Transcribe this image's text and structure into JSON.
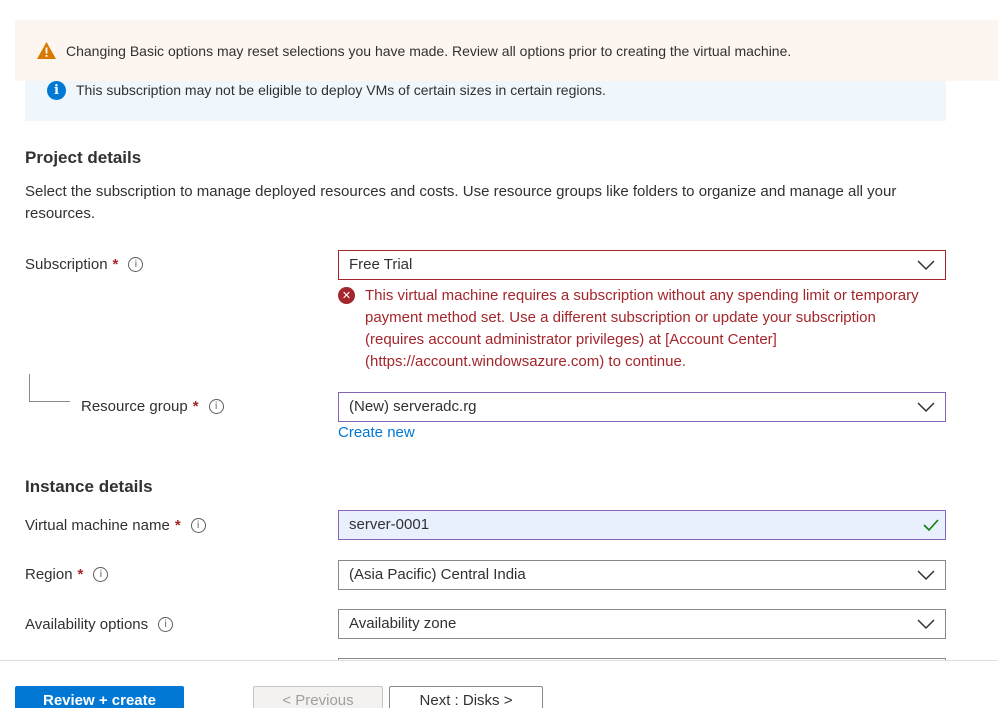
{
  "banners": {
    "warning": "Changing Basic options may reset selections you have made. Review all options prior to creating the virtual machine.",
    "info": "This subscription may not be eligible to deploy VMs of certain sizes in certain regions."
  },
  "project": {
    "title": "Project details",
    "description": "Select the subscription to manage deployed resources and costs. Use resource groups like folders to organize and manage all your resources.",
    "subscription_label": "Subscription",
    "subscription_value": "Free Trial",
    "subscription_error": "This virtual machine requires a subscription without any spending limit or temporary payment method set. Use a different subscription or update your subscription (requires account administrator privileges) at [Account Center] (https://account.windowsazure.com) to continue.",
    "resource_group_label": "Resource group",
    "resource_group_value": "(New) serveradc.rg",
    "create_new_link": "Create new"
  },
  "instance": {
    "title": "Instance details",
    "vm_name_label": "Virtual machine name",
    "vm_name_value": "server-0001",
    "region_label": "Region",
    "region_value": "(Asia Pacific) Central India",
    "availability_label": "Availability options",
    "availability_value": "Availability zone"
  },
  "symbols": {
    "required": "*",
    "tooltip": "i",
    "info": "i",
    "error": "✕"
  },
  "footer": {
    "review_create": "Review + create",
    "previous": "< Previous",
    "next": "Next : Disks >"
  },
  "colors": {
    "primary": "#0078d4",
    "error": "#a4262c",
    "warning": "#d97a00",
    "success": "#107c10",
    "focus_border": "#8764b8"
  }
}
